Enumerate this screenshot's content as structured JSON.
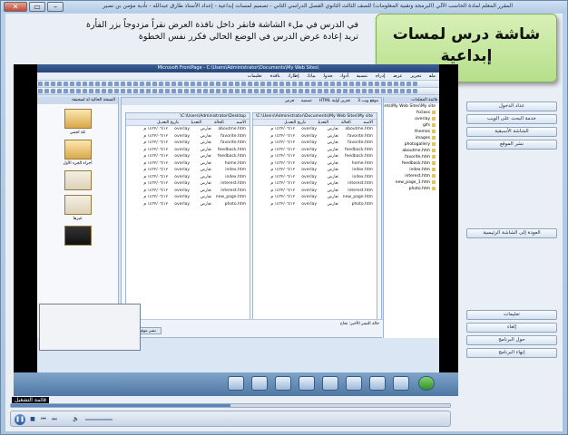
{
  "window": {
    "title": "المقرر المعلم لمادة الحاسب الآلي (البرمجة وتقنية المعلومات) للصف الثالث الثانوي الفصل الدراسي الثاني - تصميم لمسات إبداعية - إعداد الأستاذ طارق عبدالله - تأدية مؤمن بن نصير"
  },
  "instruction": {
    "line1": "في الدرس في ملء الشاشة فانقر داخل نافذة العرض نقراً مزدوجاً بزر الفأرة",
    "line2": "تريد إعادة عرض الدرس في الوضع الحالي فكرر نفس الخطوة"
  },
  "card": {
    "line1": "شاشة درس لمسات",
    "line2": "إبداعية"
  },
  "frontpage": {
    "title": "Microsoft FrontPage - C:\\Users\\Administrator\\Documents\\My Web Sites\\",
    "menu": [
      "ملف",
      "تحرير",
      "عرض",
      "إدراج",
      "تنسيق",
      "أدوات",
      "جدول",
      "بيانات",
      "إطارات",
      "نافذة",
      "تعليمات"
    ],
    "folder_header": "قائمة المجلدات",
    "folder_path": "ments\\My Web Sites\\My site\\",
    "folders": [
      "fsclass",
      "overlay",
      "gifs",
      "themes",
      "images",
      "photogallery",
      "aboutme.htm",
      "favorite.htm",
      "feedback.htm",
      "index.htm",
      "interest.htm",
      "new_page_1.htm",
      "photo.htm"
    ],
    "tabs": [
      "موقع ويب 3",
      "تحرير أولية HTML",
      "تصميم",
      "عرض"
    ],
    "remote_label": "موقع ويب البعيد",
    "remote_path": "C:\\Users\\Administrator\\Desktop\\",
    "local_label": "موقع ويب المحلي",
    "local_path": "C:\\Users\\Administrator\\Documents\\My Web Sites\\My site\\",
    "columns": [
      "الاسم",
      "الحالة",
      "التعديل",
      "تاريخ التعديل"
    ],
    "files": [
      {
        "name": "aboutme.htm",
        "status": "تعارض",
        "by": "overlay",
        "date": "١٤٣٢/٠٦/١٢ م"
      },
      {
        "name": "favorite.htm",
        "status": "تعارض",
        "by": "overlay",
        "date": "١٤٣٢/٠٦/١٢ م"
      },
      {
        "name": "favorite.htm",
        "status": "تعارض",
        "by": "overlay",
        "date": "١٤٣٢/٠٦/١٢ م"
      },
      {
        "name": "feedback.htm",
        "status": "تعارض",
        "by": "overlay",
        "date": "١٤٣٢/٠٦/١٢ م"
      },
      {
        "name": "feedback.htm",
        "status": "تعارض",
        "by": "overlay",
        "date": "١٤٣٢/٠٦/١٢ م"
      },
      {
        "name": "home.htm",
        "status": "تعارض",
        "by": "overlay",
        "date": "١٤٣٢/٠٦/١٢ م"
      },
      {
        "name": "index.htm",
        "status": "تعارض",
        "by": "overlay",
        "date": "١٤٣٢/٠٦/١٢ م"
      },
      {
        "name": "index.htm",
        "status": "تعارض",
        "by": "overlay",
        "date": "١٤٣٢/٠٦/١٢ م"
      },
      {
        "name": "interest.htm",
        "status": "تعارض",
        "by": "overlay",
        "date": "١٤٣٢/٠٦/١٢ م"
      },
      {
        "name": "interest.htm",
        "status": "تعارض",
        "by": "overlay",
        "date": "١٤٣٢/٠٦/١٢ م"
      },
      {
        "name": "new_page.htm",
        "status": "تعارض",
        "by": "overlay",
        "date": "١٤٣٢/٠٦/١٢ م"
      },
      {
        "name": "photo.htm",
        "status": "تعارض",
        "by": "overlay",
        "date": "١٤٣٢/٠٦/١٢ م"
      }
    ],
    "left_header": "النسخة الحالية لة لسحيفة",
    "thumb_labels": [
      "تلة لحيتي",
      "أجزاء الجزء الأول",
      "غيرها"
    ],
    "status_text": "حالة النشر الأخير: نجاح",
    "publish_button": "نشر موقع ويب"
  },
  "buttons_top": [
    "عداد الدخول",
    "خدمة البحث على الويب",
    "الشاشة الأسبقية",
    "نشر الموقع"
  ],
  "button_home": "العودة إلى الشاشة الرئيسية",
  "buttons_bottom": [
    "تعليمات",
    "إلغاء",
    "حول البرنامج",
    "إنهاء البرنامج"
  ],
  "player": {
    "name": "قائمة التشغيل",
    "progress": 0.5
  }
}
